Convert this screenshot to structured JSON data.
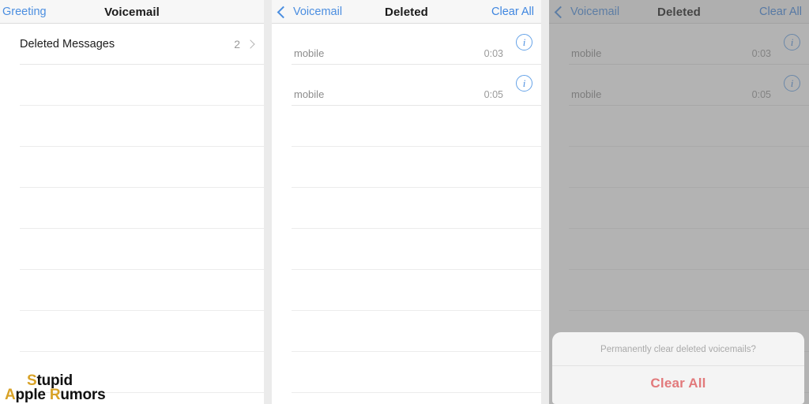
{
  "panels": {
    "left": {
      "nav": {
        "back_label": "Greeting",
        "title": "Voicemail"
      },
      "rows": [
        {
          "label": "Deleted Messages",
          "count": "2",
          "accessory": "chevron-right-icon"
        }
      ],
      "empty_row_count": 8
    },
    "middle": {
      "nav": {
        "back_label": "Voicemail",
        "back_icon": "chevron-left-icon",
        "title": "Deleted",
        "action_label": "Clear All"
      },
      "voicemails": [
        {
          "caller": "mobile",
          "duration": "0:03",
          "info_icon": "info-circle-icon"
        },
        {
          "caller": "mobile",
          "duration": "0:05",
          "info_icon": "info-circle-icon"
        }
      ],
      "empty_row_count": 7
    },
    "right": {
      "nav": {
        "back_label": "Voicemail",
        "back_icon": "chevron-left-icon",
        "title": "Deleted",
        "action_label": "Clear All"
      },
      "voicemails": [
        {
          "caller": "mobile",
          "duration": "0:03",
          "info_icon": "info-circle-icon"
        },
        {
          "caller": "mobile",
          "duration": "0:05",
          "info_icon": "info-circle-icon"
        }
      ],
      "empty_row_count": 7,
      "alert": {
        "message": "Permanently clear deleted voicemails?",
        "action_label": "Clear All"
      }
    }
  },
  "watermark": {
    "line1_initial": "S",
    "line1_rest": "tupid",
    "line2_initial_a": "A",
    "line2_mid": "pple ",
    "line2_initial_r": "R",
    "line2_rest": "umors"
  },
  "colors": {
    "accent_blue": "#4b8ee0",
    "destructive_red": "#e2797b",
    "watermark_gold": "#d8a227",
    "separator": "#e6e6e6",
    "navbar_bg": "#f7f7f7"
  }
}
